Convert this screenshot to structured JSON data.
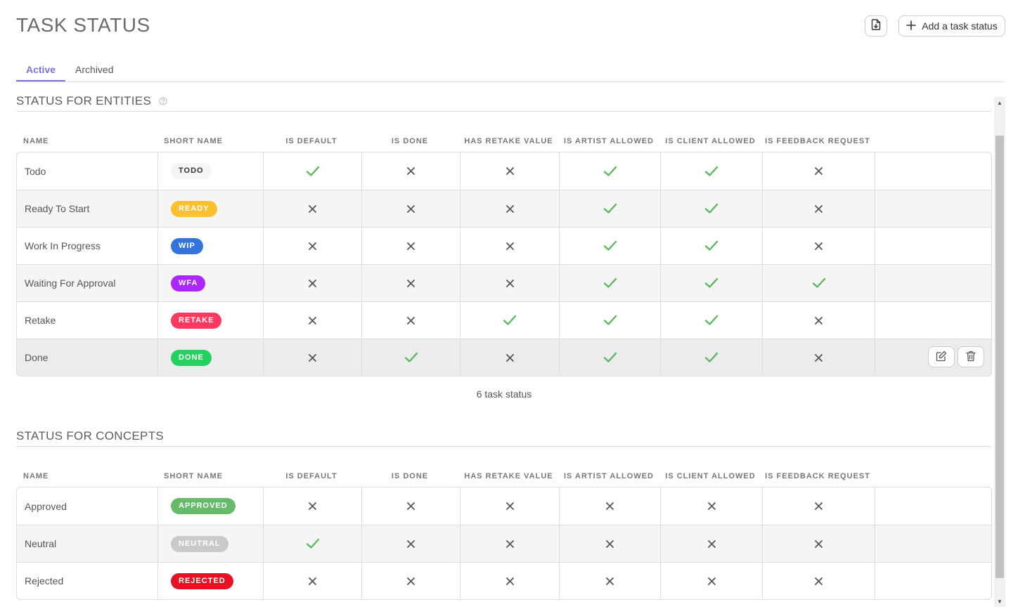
{
  "page": {
    "title": "TASK STATUS",
    "add_button_label": "Add a task status"
  },
  "tabs": [
    {
      "label": "Active",
      "active": true
    },
    {
      "label": "Archived",
      "active": false
    }
  ],
  "columns": [
    "NAME",
    "SHORT NAME",
    "IS DEFAULT",
    "IS DONE",
    "HAS RETAKE VALUE",
    "IS ARTIST ALLOWED",
    "IS CLIENT ALLOWED",
    "IS FEEDBACK REQUEST"
  ],
  "entities": {
    "title": "STATUS FOR ENTITIES",
    "count_label": "6 task status",
    "rows": [
      {
        "name": "Todo",
        "short": "TODO",
        "color": "#f5f5f5",
        "text_color": "#333333",
        "flags": [
          true,
          false,
          false,
          true,
          true,
          false
        ]
      },
      {
        "name": "Ready To Start",
        "short": "READY",
        "color": "#fbc02d",
        "text_color": "#ffffff",
        "flags": [
          false,
          false,
          false,
          true,
          true,
          false
        ]
      },
      {
        "name": "Work In Progress",
        "short": "WIP",
        "color": "#3273dc",
        "text_color": "#ffffff",
        "flags": [
          false,
          false,
          false,
          true,
          true,
          false
        ]
      },
      {
        "name": "Waiting For Approval",
        "short": "WFA",
        "color": "#ab26ff",
        "text_color": "#ffffff",
        "flags": [
          false,
          false,
          false,
          true,
          true,
          true
        ]
      },
      {
        "name": "Retake",
        "short": "RETAKE",
        "color": "#ff3860",
        "text_color": "#ffffff",
        "flags": [
          false,
          false,
          true,
          true,
          true,
          false
        ]
      },
      {
        "name": "Done",
        "short": "DONE",
        "color": "#22d160",
        "text_color": "#ffffff",
        "flags": [
          false,
          true,
          false,
          true,
          true,
          false
        ]
      }
    ]
  },
  "concepts": {
    "title": "STATUS FOR CONCEPTS",
    "rows": [
      {
        "name": "Approved",
        "short": "APPROVED",
        "color": "#66bb6a",
        "text_color": "#ffffff",
        "flags": [
          false,
          false,
          false,
          false,
          false,
          false
        ]
      },
      {
        "name": "Neutral",
        "short": "NEUTRAL",
        "color": "#cacaca",
        "text_color": "#ffffff",
        "flags": [
          true,
          false,
          false,
          false,
          false,
          false
        ]
      },
      {
        "name": "Rejected",
        "short": "REJECTED",
        "color": "#e81123",
        "text_color": "#ffffff",
        "flags": [
          false,
          false,
          false,
          false,
          false,
          false
        ]
      }
    ]
  },
  "colors": {
    "accent": "#7b71d6",
    "check": "#5cb85c",
    "cross": "#555555"
  },
  "icons": {
    "import": "file-import-icon",
    "add": "plus-icon",
    "edit": "edit-icon",
    "delete": "trash-icon",
    "help": "help-circle-icon"
  }
}
